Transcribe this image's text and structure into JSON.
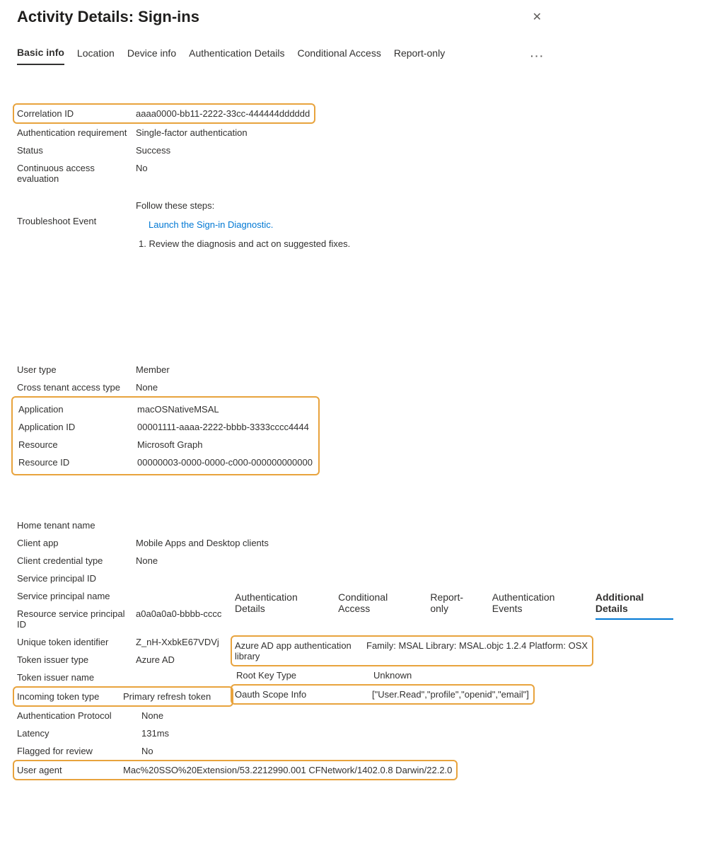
{
  "header": {
    "title": "Activity Details: Sign-ins"
  },
  "tabs": [
    "Basic info",
    "Location",
    "Device info",
    "Authentication Details",
    "Conditional Access",
    "Report-only"
  ],
  "more": "···",
  "section1": {
    "correlation_id_l": "Correlation ID",
    "correlation_id_v": "aaaa0000-bb11-2222-33cc-444444dddddd",
    "auth_req_l": "Authentication requirement",
    "auth_req_v": "Single-factor authentication",
    "status_l": "Status",
    "status_v": "Success",
    "cae_l": "Continuous access evaluation",
    "cae_v": "No"
  },
  "troubleshoot": {
    "label": "Troubleshoot Event",
    "intro": "Follow these steps:",
    "link": "Launch the Sign-in Diagnostic.",
    "step1": "1. Review the diagnosis and act on suggested fixes."
  },
  "section3": {
    "user_type_l": "User type",
    "user_type_v": "Member",
    "cross_tenant_l": "Cross tenant access type",
    "cross_tenant_v": "None",
    "application_l": "Application",
    "application_v": "macOSNativeMSAL",
    "app_id_l": "Application ID",
    "app_id_v": "00001111-aaaa-2222-bbbb-3333cccc4444",
    "resource_l": "Resource",
    "resource_v": "Microsoft Graph",
    "resource_id_l": "Resource ID",
    "resource_id_v": "00000003-0000-0000-c000-000000000000"
  },
  "section4": {
    "home_tenant_l": "Home tenant name",
    "home_tenant_v": "",
    "client_app_l": "Client app",
    "client_app_v": "Mobile Apps and Desktop clients",
    "cred_type_l": "Client credential type",
    "cred_type_v": "None",
    "spid_l": "Service principal ID",
    "spid_v": "",
    "spname_l": "Service principal name",
    "spname_v": "",
    "rsp_id_l": "Resource service principal ID",
    "rsp_id_v": "a0a0a0a0-bbbb-cccc",
    "uti_l": "Unique token identifier",
    "uti_v": "Z_nH-XxbkE67VDVj",
    "token_issuer_type_l": "Token issuer type",
    "token_issuer_type_v": "Azure AD",
    "token_issuer_name_l": "Token issuer name",
    "token_issuer_name_v": ""
  },
  "section5": {
    "incoming_token_l": "Incoming token type",
    "incoming_token_v": "Primary refresh token",
    "auth_proto_l": "Authentication Protocol",
    "auth_proto_v": "None",
    "latency_l": "Latency",
    "latency_v": "131ms",
    "flagged_l": "Flagged for review",
    "flagged_v": "No",
    "user_agent_l": "User agent",
    "user_agent_v": "Mac%20SSO%20Extension/53.2212990.001 CFNetwork/1402.0.8 Darwin/22.2.0"
  },
  "sec_tabs": [
    "Authentication Details",
    "Conditional Access",
    "Report-only",
    "Authentication Events",
    "Additional Details"
  ],
  "sec_details": {
    "lib_l": "Azure AD app authentication library",
    "lib_v": "Family: MSAL Library: MSAL.objc 1.2.4 Platform: OSX",
    "root_key_l": "Root Key Type",
    "root_key_v": "Unknown",
    "oauth_l": "Oauth Scope Info",
    "oauth_v": "[\"User.Read\",\"profile\",\"openid\",\"email\"]"
  }
}
